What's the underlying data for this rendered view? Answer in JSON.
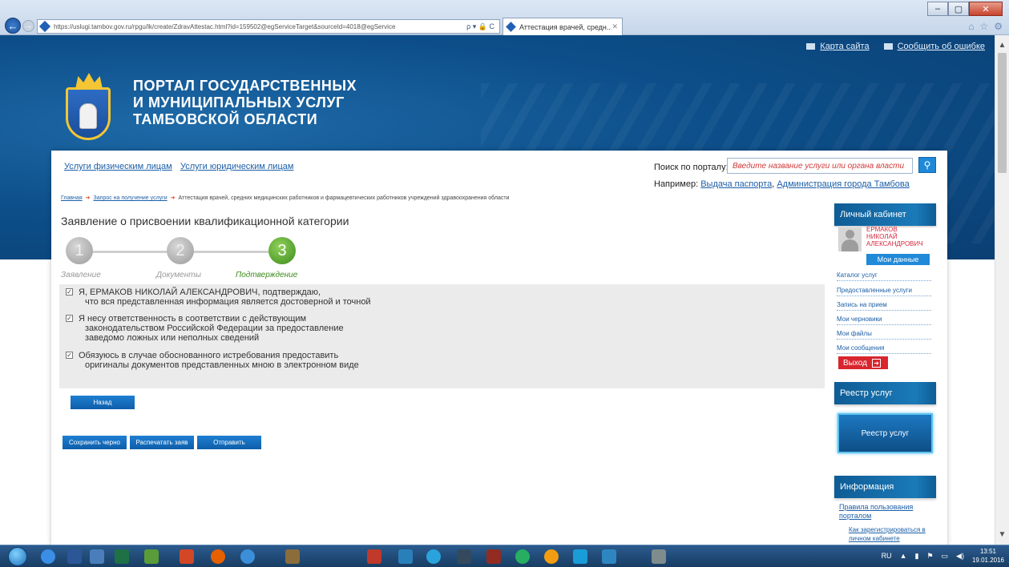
{
  "browser": {
    "url": "https://uslugi.tambov.gov.ru/rpgu/lk/create/ZdravAttestac.html?id=159502@egServiceTarget&sourceId=4018@egService",
    "tab_title": "Аттестация врачей, средн...",
    "nav_icons": [
      "back-icon",
      "forward-icon"
    ],
    "address_tools": "ρ ▾ 🔒 C"
  },
  "header": {
    "top_links": [
      "Карта сайта",
      "Сообщить об ошибке"
    ],
    "portal_title": [
      "ПОРТАЛ ГОСУДАРСТВЕННЫХ",
      "И МУНИЦИПАЛЬНЫХ УСЛУГ",
      "ТАМБОВСКОЙ ОБЛАСТИ"
    ]
  },
  "nav": {
    "tabs": [
      "Услуги физическим лицам",
      "Услуги юридическим лицам"
    ],
    "search_label": "Поиск по порталу:",
    "search_placeholder": "Введите название услуги или органа власти",
    "example_label": "Например:",
    "example_links": [
      "Выдача паспорта",
      "Администрация города Тамбова"
    ]
  },
  "breadcrumb": [
    "Главная",
    "Запрос на получение услуги",
    "Аттестация врачей, средних медицинских работников и фармацевтических работников учреждений здравоохранения области"
  ],
  "form": {
    "title": "Заявление о присвоении квалификационной категории",
    "steps": [
      {
        "number": "1",
        "label": "Заявление",
        "active": false
      },
      {
        "number": "2",
        "label": "Документы",
        "active": false
      },
      {
        "number": "3",
        "label": "Подтверждение",
        "active": true
      }
    ],
    "checkboxes": [
      {
        "checked": true,
        "lines": [
          "Я, ЕРМАКОВ НИКОЛАЙ АЛЕКСАНДРОВИЧ, подтверждаю,",
          "что вся представленная информация является достоверной и точной"
        ]
      },
      {
        "checked": true,
        "lines": [
          "Я несу ответственность в соответствии с действующим",
          "законодательством Российской Федерации за предоставление",
          "заведомо ложных или неполных сведений"
        ]
      },
      {
        "checked": true,
        "lines": [
          "Обязуюсь в случае обоснованного истребования предоставить",
          "оригиналы документов представленных мною в электронном виде"
        ]
      }
    ],
    "back_button": "Назад",
    "action_buttons": [
      "Сохранить черно",
      "Распечатать заяв",
      "Отправить"
    ]
  },
  "sidebar": {
    "cabinet_title": "Личный кабинет",
    "user_name": [
      "ЕРМАКОВ",
      "НИКОЛАЙ",
      "АЛЕКСАНДРОВИЧ"
    ],
    "my_data_button": "Мои данные",
    "links": [
      "Каталог услуг",
      "Предоставленные услуги",
      "Запись на прием",
      "Мои черновики",
      "Мои файлы",
      "Мои сообщения"
    ],
    "logout_button": "Выход",
    "registry_title": "Реестр услуг",
    "registry_card": "Реестр услуг",
    "info_title": "Информация",
    "info_links": [
      "Правила пользования порталом",
      "Как зарегистрироваться в личном кабинете"
    ]
  },
  "taskbar": {
    "lang": "RU",
    "time": "13:51",
    "date": "19.01.2016"
  }
}
